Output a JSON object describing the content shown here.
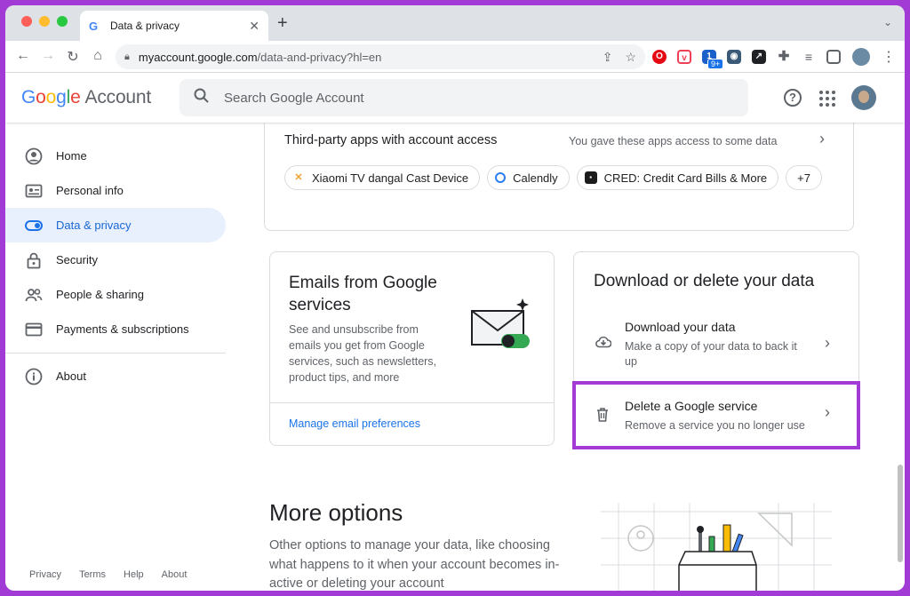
{
  "browser": {
    "tab_title": "Data & privacy",
    "tab_favicon": "G",
    "new_tab": "+",
    "url_host": "myaccount.google.com",
    "url_path": "/data-and-privacy?hl=en",
    "ext_badge": "9+"
  },
  "header": {
    "logo_word": "Google",
    "logo_account": "Account",
    "search_placeholder": "Search Google Account",
    "help_glyph": "?"
  },
  "sidebar": {
    "items": [
      {
        "label": "Home",
        "icon": "home-icon"
      },
      {
        "label": "Personal info",
        "icon": "id-card-icon"
      },
      {
        "label": "Data & privacy",
        "icon": "toggle-icon"
      },
      {
        "label": "Security",
        "icon": "lock-icon"
      },
      {
        "label": "People & sharing",
        "icon": "people-icon"
      },
      {
        "label": "Payments & subscriptions",
        "icon": "credit-card-icon"
      },
      {
        "label": "About",
        "icon": "info-icon"
      }
    ],
    "footer": [
      "Privacy",
      "Terms",
      "Help",
      "About"
    ]
  },
  "third_party": {
    "label": "Third-party apps with account access",
    "description": "You gave these apps access to some data",
    "chips": [
      {
        "label": "Xiaomi TV dangal Cast Device"
      },
      {
        "label": "Calendly"
      },
      {
        "label": "CRED: Credit Card Bills & More"
      }
    ],
    "more": "+7"
  },
  "emails_card": {
    "title": "Emails from Google services",
    "description": "See and unsubscribe from emails you get from Google services, such as newsletters, product tips, and more",
    "link": "Manage email preferences"
  },
  "download_card": {
    "title": "Download or delete your data",
    "download_title": "Download your data",
    "download_desc": "Make a copy of your data to back it up",
    "delete_title": "Delete a Google service",
    "delete_desc": "Remove a service you no longer use"
  },
  "more_options": {
    "title": "More options",
    "description": "Other options to manage your data, like choosing what happens to it when your account becomes in-active or deleting your account"
  },
  "colors": {
    "accent": "#1a73e8",
    "active_nav_bg": "#e8f0fe",
    "highlight_border": "#a23bd6"
  }
}
